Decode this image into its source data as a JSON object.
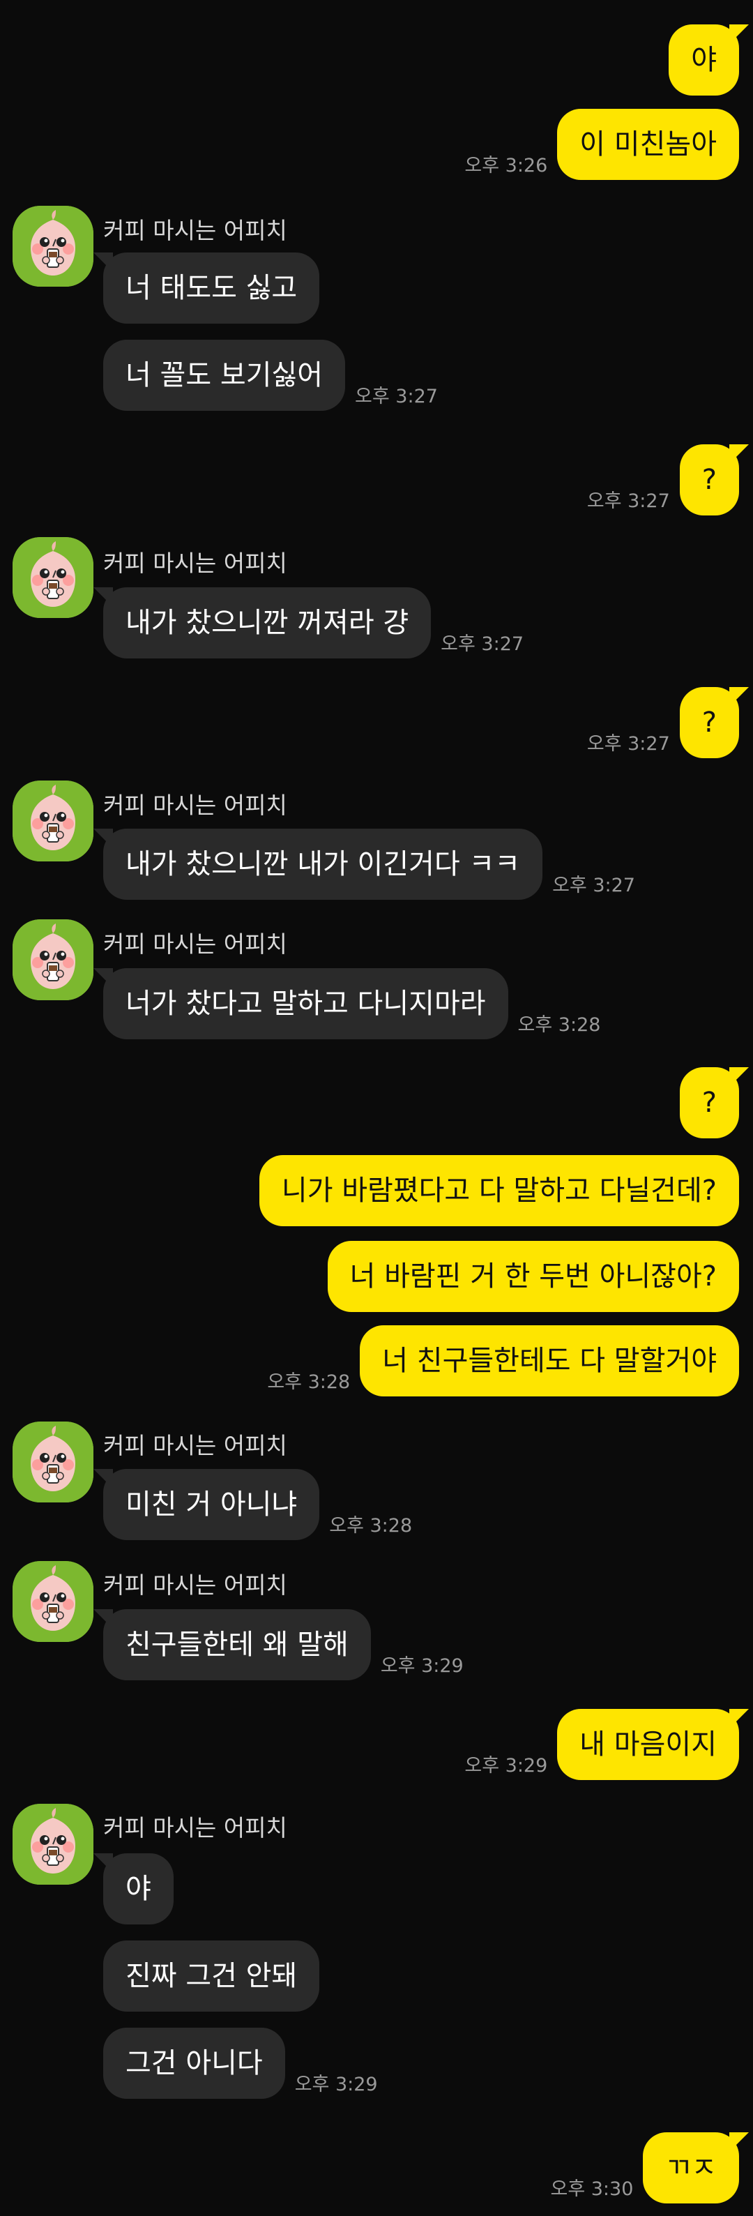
{
  "chat": {
    "sender_name": "커피 마시는 어피치",
    "colors": {
      "background": "#0b0b0b",
      "outgoing_bubble": "#fee500",
      "incoming_bubble": "#2a2a2a",
      "timestamp": "#9a9a9a",
      "avatar_bg": "#7cb82f"
    },
    "avatar_icon": "apeach-coffee-icon",
    "messages": [
      {
        "dir": "out",
        "text": "야",
        "time": ""
      },
      {
        "dir": "out",
        "text": "이 미친놈아",
        "time": "오후 3:26"
      },
      {
        "dir": "in",
        "text": "너 태도도 싫고",
        "time": ""
      },
      {
        "dir": "in",
        "text": "너 꼴도 보기싫어",
        "time": "오후 3:27"
      },
      {
        "dir": "out",
        "text": "?",
        "time": "오후 3:27"
      },
      {
        "dir": "in",
        "text": "내가 찼으니깐 꺼져라 걍",
        "time": "오후 3:27"
      },
      {
        "dir": "out",
        "text": "?",
        "time": "오후 3:27"
      },
      {
        "dir": "in",
        "text": "내가 찼으니깐 내가 이긴거다 ㅋㅋ",
        "time": "오후 3:27"
      },
      {
        "dir": "in",
        "text": "너가 찼다고 말하고 다니지마라",
        "time": "오후 3:28"
      },
      {
        "dir": "out",
        "text": "?",
        "time": ""
      },
      {
        "dir": "out",
        "text": "니가 바람폈다고 다 말하고 다닐건데?",
        "time": ""
      },
      {
        "dir": "out",
        "text": "너 바람핀 거 한 두번 아니잖아?",
        "time": ""
      },
      {
        "dir": "out",
        "text": "너 친구들한테도 다 말할거야",
        "time": "오후 3:28"
      },
      {
        "dir": "in",
        "text": "미친 거 아니냐",
        "time": "오후 3:28"
      },
      {
        "dir": "in",
        "text": "친구들한테 왜 말해",
        "time": "오후 3:29"
      },
      {
        "dir": "out",
        "text": "내 마음이지",
        "time": "오후 3:29"
      },
      {
        "dir": "in",
        "text": "야",
        "time": ""
      },
      {
        "dir": "in",
        "text": "진짜 그건 안돼",
        "time": ""
      },
      {
        "dir": "in",
        "text": "그건 아니다",
        "time": "오후 3:29"
      },
      {
        "dir": "out",
        "text": "ㄲㅈ",
        "time": "오후 3:30"
      }
    ]
  }
}
